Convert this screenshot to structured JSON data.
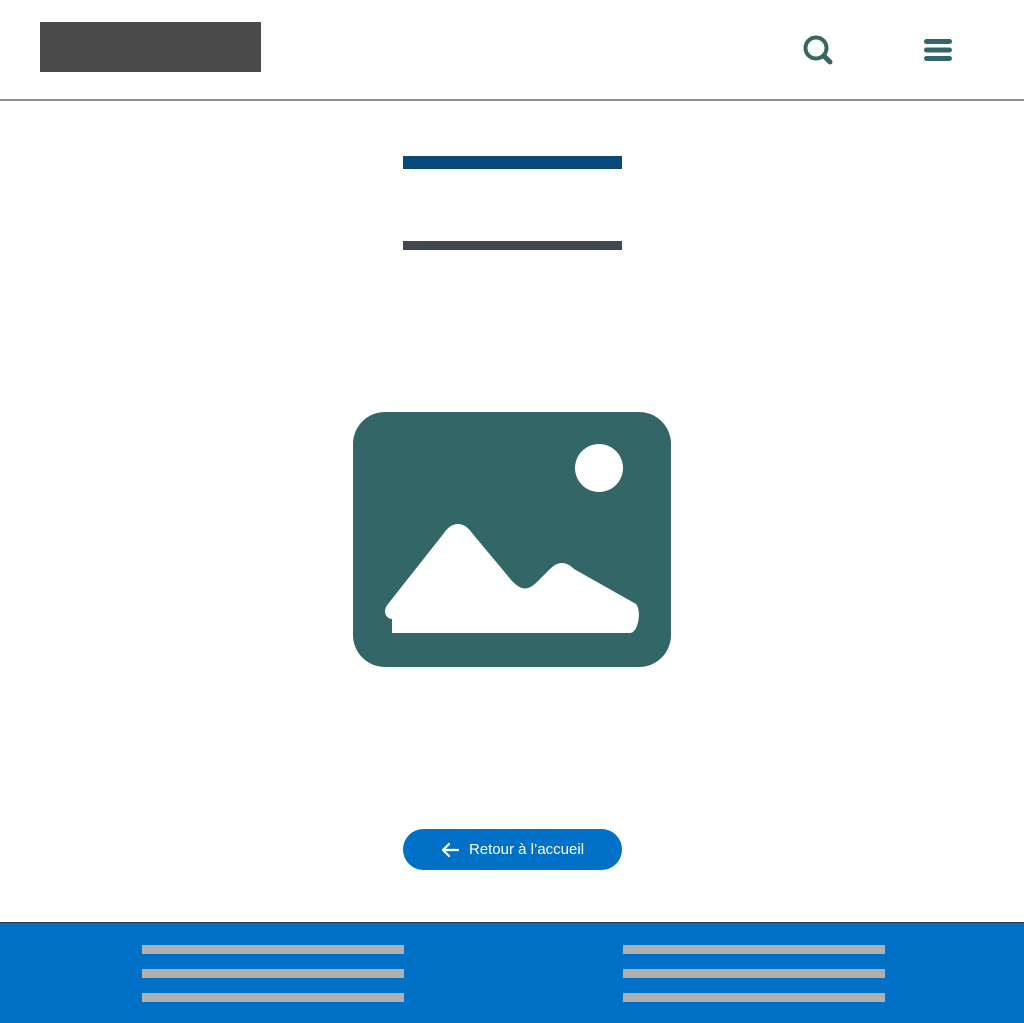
{
  "colors": {
    "brand_teal": "#336666",
    "title_navy": "#0a4a7a",
    "subtitle_gray": "#3f4850",
    "logo_gray": "#4a4a4a",
    "button_blue": "#0071c6",
    "footer_blue": "#0071c6",
    "footer_line_gray": "#b0b0b0"
  },
  "header": {
    "logo_icon": "logo-placeholder",
    "search_icon": "search-icon",
    "menu_icon": "hamburger-menu-icon"
  },
  "main": {
    "image_icon": "image-placeholder-icon",
    "back_button": {
      "icon": "arrow-left-icon",
      "label": "Retour à l’accueil"
    }
  },
  "footer": {
    "columns": 2,
    "lines_per_column": 3
  }
}
